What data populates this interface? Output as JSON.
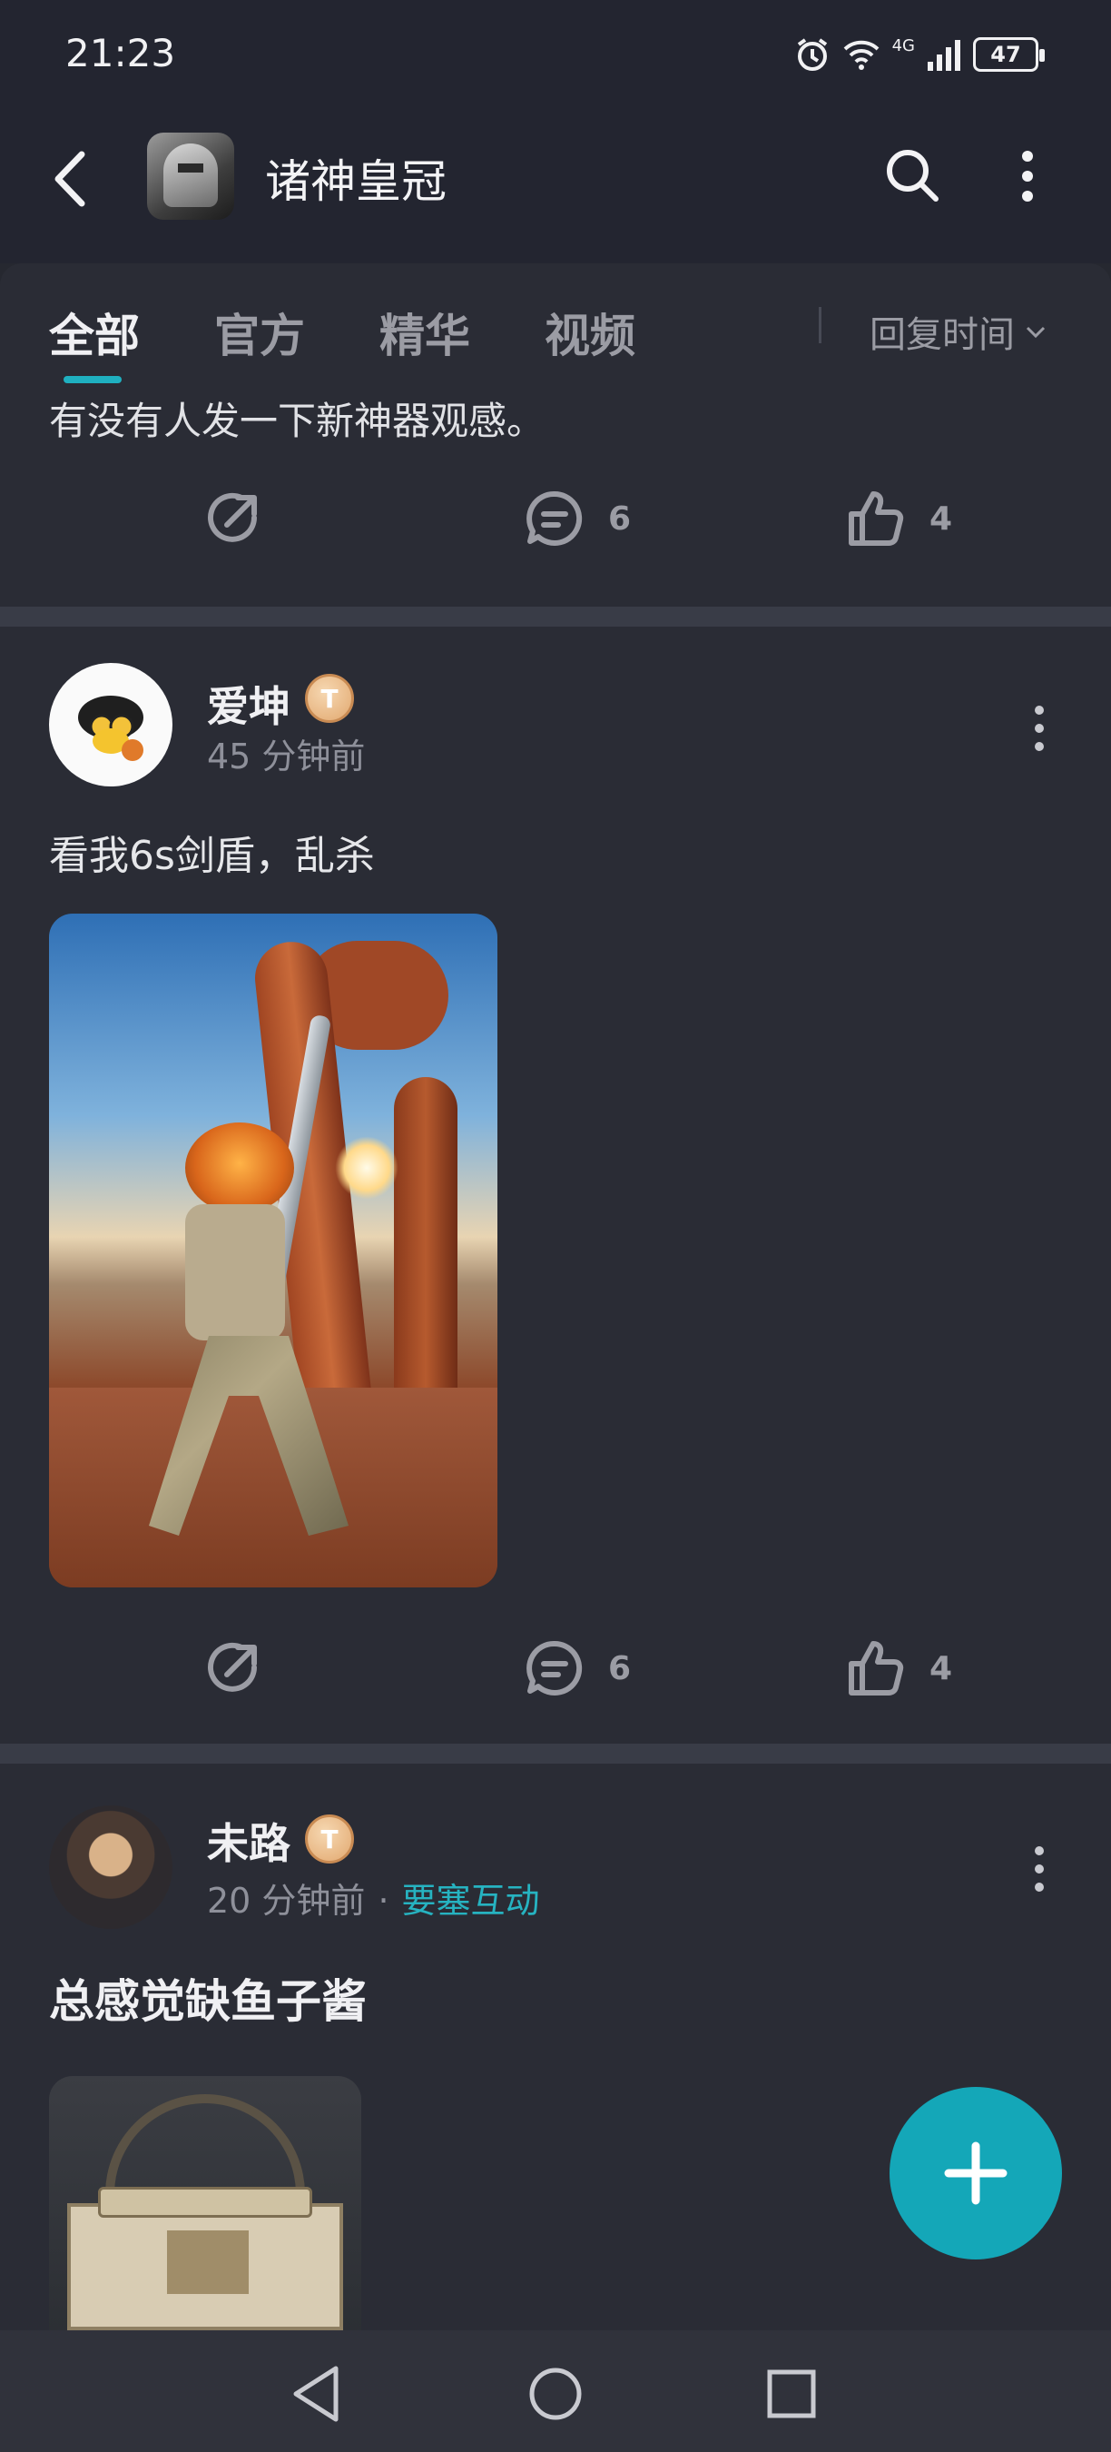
{
  "status_bar": {
    "time": "21:23",
    "network": "4G",
    "battery": "47"
  },
  "header": {
    "back_icon": "back-arrow-icon",
    "title": "诸神皇冠",
    "search_icon": "search-icon",
    "menu_icon": "more-vertical-icon"
  },
  "tabs": {
    "items": [
      {
        "label": "全部",
        "active": true
      },
      {
        "label": "官方",
        "active": false
      },
      {
        "label": "精华",
        "active": false
      },
      {
        "label": "视频",
        "active": false
      }
    ],
    "sort_label": "回复时间",
    "accent_color": "#1fb0c0"
  },
  "previous_post": {
    "text": "有没有人发一下新神器观感。",
    "comments": "6",
    "likes": "4"
  },
  "posts": [
    {
      "username": "爱坤",
      "level": "T",
      "time": "45 分钟前",
      "text": "看我6s剑盾，乱杀",
      "comments": "6",
      "likes": "4"
    },
    {
      "username": "未路",
      "level": "T",
      "time": "20 分钟前",
      "separator": "·",
      "tag": "要塞互动",
      "title": "总感觉缺鱼子酱"
    }
  ],
  "fab": {
    "icon": "plus-icon",
    "color": "#14a7b8"
  },
  "nav": {
    "back": "nav-back-icon",
    "home": "nav-home-icon",
    "recent": "nav-recent-icon"
  }
}
